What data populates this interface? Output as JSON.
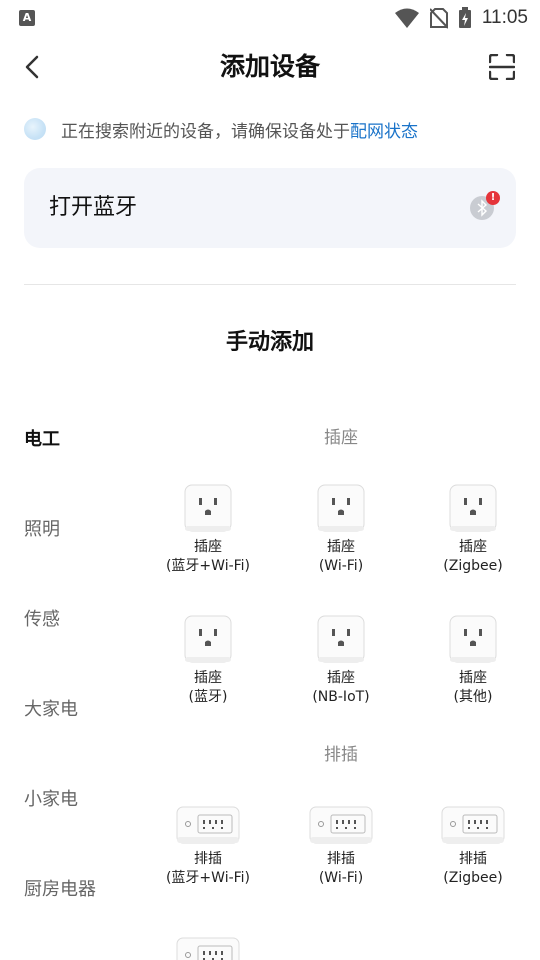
{
  "status_bar": {
    "time": "11:05",
    "app_badge": "A"
  },
  "header": {
    "title": "添加设备"
  },
  "notice": {
    "text": "正在搜索附近的设备，请确保设备处于",
    "link": "配网状态"
  },
  "bluetooth": {
    "label": "打开蓝牙"
  },
  "section": {
    "title": "手动添加"
  },
  "categories": [
    {
      "label": "电工",
      "active": true
    },
    {
      "label": "照明"
    },
    {
      "label": "传感"
    },
    {
      "label": "大家电"
    },
    {
      "label": "小家电"
    },
    {
      "label": "厨房电器"
    }
  ],
  "groups": [
    {
      "title": "插座",
      "items": [
        {
          "name": "插座",
          "sub": "(蓝牙+Wi-Fi)"
        },
        {
          "name": "插座",
          "sub": "(Wi-Fi)"
        },
        {
          "name": "插座",
          "sub": "(Zigbee)"
        },
        {
          "name": "插座",
          "sub": "(蓝牙)"
        },
        {
          "name": "插座",
          "sub": "(NB-IoT)"
        },
        {
          "name": "插座",
          "sub": "(其他)"
        }
      ]
    },
    {
      "title": "排插",
      "items": [
        {
          "name": "排插",
          "sub": "(蓝牙+Wi-Fi)"
        },
        {
          "name": "排插",
          "sub": "(Wi-Fi)"
        },
        {
          "name": "排插",
          "sub": "(Zigbee)"
        }
      ]
    }
  ]
}
